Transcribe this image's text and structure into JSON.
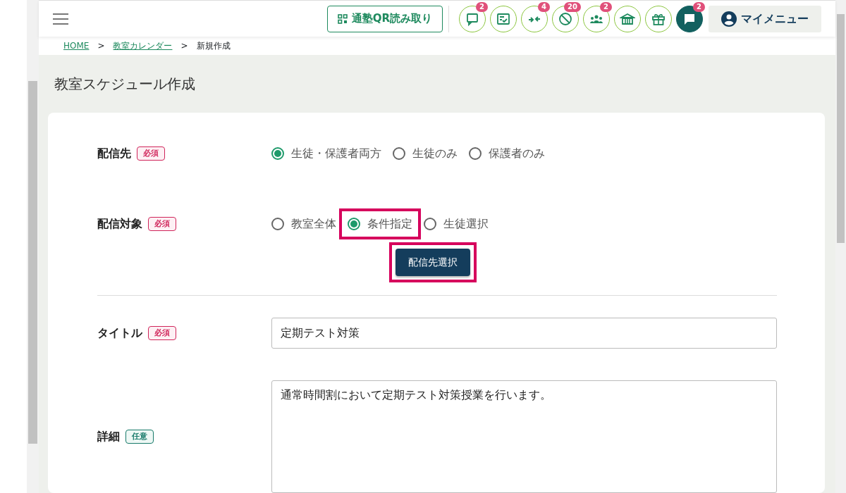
{
  "header": {
    "qr_button": "通塾QR読み取り",
    "icons": [
      {
        "badge": "2",
        "filled": false
      },
      {
        "filled": false
      },
      {
        "badge": "4",
        "filled": false
      },
      {
        "badge": "20",
        "filled": false
      },
      {
        "badge": "2",
        "filled": false
      },
      {
        "filled": false
      },
      {
        "filled": false
      },
      {
        "badge": "2",
        "filled": true
      }
    ],
    "menu": "マイメニュー"
  },
  "breadcrumb": [
    {
      "label": "HOME",
      "link": true
    },
    {
      "label": ">",
      "link": false
    },
    {
      "label": "教室カレンダー",
      "link": true
    },
    {
      "label": ">",
      "link": false
    },
    {
      "label": "新規作成",
      "link": false
    }
  ],
  "page_title": "教室スケジュール作成",
  "form": {
    "recipients": {
      "label": "配信先",
      "badge": {
        "text": "必須",
        "kind": "required"
      },
      "options": [
        {
          "label": "生徒・保護者両方",
          "selected": true,
          "highlighted": false
        },
        {
          "label": "生徒のみ",
          "selected": false,
          "highlighted": false
        },
        {
          "label": "保護者のみ",
          "selected": false,
          "highlighted": false
        }
      ]
    },
    "target": {
      "label": "配信対象",
      "badge": {
        "text": "必須",
        "kind": "required"
      },
      "options": [
        {
          "label": "教室全体",
          "selected": false,
          "highlighted": false
        },
        {
          "label": "条件指定",
          "selected": true,
          "highlighted": true
        },
        {
          "label": "生徒選択",
          "selected": false,
          "highlighted": false
        }
      ],
      "button": {
        "label": "配信先選択",
        "highlighted": true
      }
    },
    "title": {
      "label": "タイトル",
      "badge": {
        "text": "必須",
        "kind": "required"
      },
      "value": "定期テスト対策"
    },
    "detail": {
      "label": "詳細",
      "badge": {
        "text": "任意",
        "kind": "optional"
      },
      "value": "通常時間割において定期テスト対策授業を行います。"
    }
  }
}
